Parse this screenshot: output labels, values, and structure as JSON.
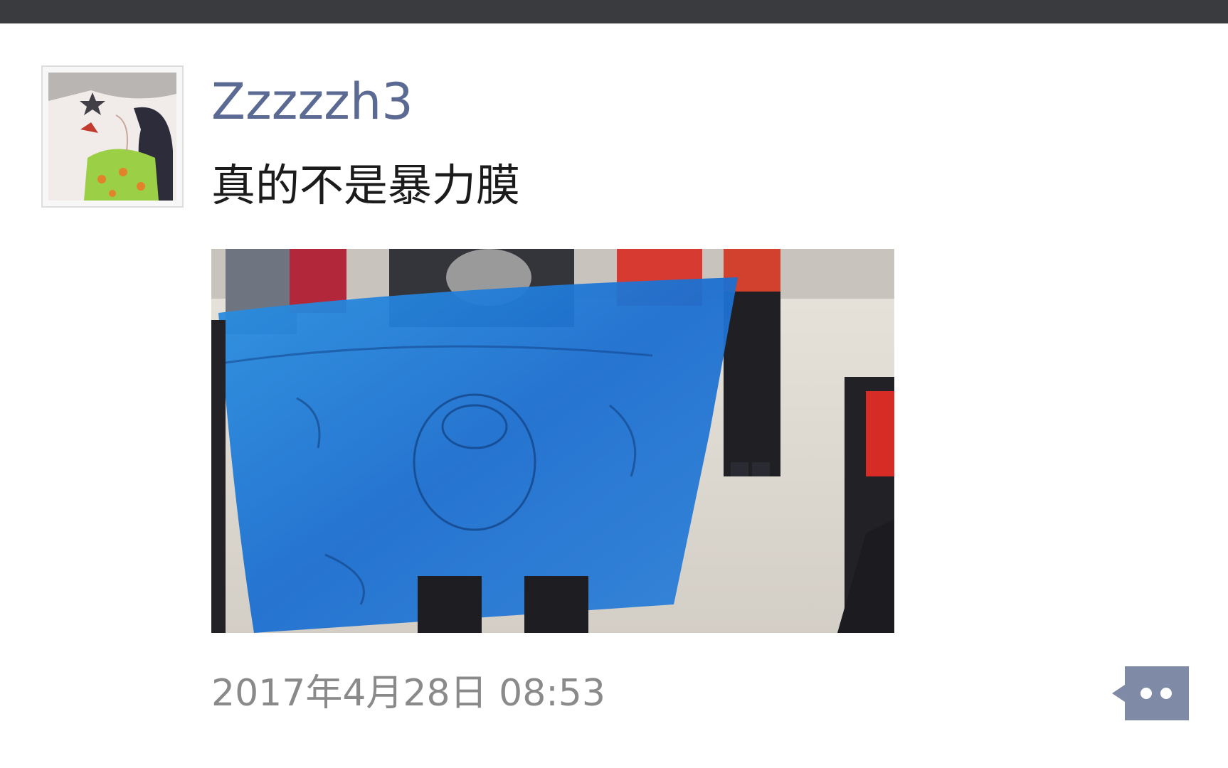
{
  "post": {
    "username": "Zzzzzh3",
    "text": "真的不是暴力膜",
    "timestamp": "2017年4月28日 08:53"
  },
  "avatar": {
    "icon": "illustrated-avatar-icon"
  },
  "photo": {
    "icon": "photo-blue-banner"
  },
  "comment_button": {
    "icon": "comment-dots-icon"
  },
  "colors": {
    "topbar": "#3a3b3f",
    "username": "#5b6a92",
    "text": "#1b1b1b",
    "timestamp": "#8a8a8a",
    "comment_button": "#7f8aa6"
  }
}
